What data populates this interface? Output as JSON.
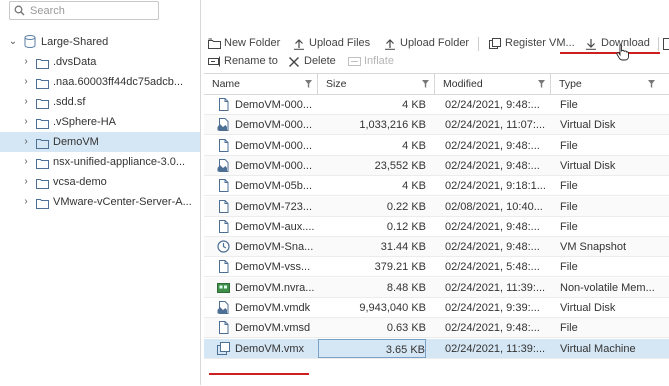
{
  "search": {
    "placeholder": "Search"
  },
  "tree": {
    "root_label": "Large-Shared",
    "items": [
      {
        "label": ".dvsData",
        "selected": false
      },
      {
        "label": ".naa.60003ff44dc75adcb...",
        "selected": false
      },
      {
        "label": ".sdd.sf",
        "selected": false
      },
      {
        "label": ".vSphere-HA",
        "selected": false
      },
      {
        "label": "DemoVM",
        "selected": true
      },
      {
        "label": "nsx-unified-appliance-3.0...",
        "selected": false
      },
      {
        "label": "vcsa-demo",
        "selected": false
      },
      {
        "label": "VMware-vCenter-Server-A...",
        "selected": false
      }
    ]
  },
  "toolbar": {
    "new_folder": "New Folder",
    "upload_files": "Upload Files",
    "upload_folder": "Upload Folder",
    "register_vm": "Register VM...",
    "download": "Download",
    "rename_to": "Rename to",
    "delete": "Delete",
    "inflate": "Inflate"
  },
  "columns": {
    "name": "Name",
    "size": "Size",
    "modified": "Modified",
    "type": "Type"
  },
  "files": [
    {
      "name": "DemoVM-000...",
      "size": "4 KB",
      "modified": "02/24/2021, 9:48:...",
      "type": "File",
      "icon": "file-icon",
      "selected": false
    },
    {
      "name": "DemoVM-000...",
      "size": "1,033,216 KB",
      "modified": "02/24/2021, 11:07:...",
      "type": "Virtual Disk",
      "icon": "virtual-disk-icon",
      "selected": false
    },
    {
      "name": "DemoVM-000...",
      "size": "4 KB",
      "modified": "02/24/2021, 9:48:...",
      "type": "File",
      "icon": "file-icon",
      "selected": false
    },
    {
      "name": "DemoVM-000...",
      "size": "23,552 KB",
      "modified": "02/24/2021, 9:48:...",
      "type": "Virtual Disk",
      "icon": "virtual-disk-icon",
      "selected": false
    },
    {
      "name": "DemoVM-05b...",
      "size": "4 KB",
      "modified": "02/24/2021, 9:18:1...",
      "type": "File",
      "icon": "file-icon",
      "selected": false
    },
    {
      "name": "DemoVM-723...",
      "size": "0.22 KB",
      "modified": "02/08/2021, 10:40...",
      "type": "File",
      "icon": "file-icon",
      "selected": false
    },
    {
      "name": "DemoVM-aux....",
      "size": "0.12 KB",
      "modified": "02/24/2021, 9:48:...",
      "type": "File",
      "icon": "file-icon",
      "selected": false
    },
    {
      "name": "DemoVM-Sna...",
      "size": "31.44 KB",
      "modified": "02/24/2021, 9:48:...",
      "type": "VM Snapshot",
      "icon": "vm-snapshot-icon",
      "selected": false
    },
    {
      "name": "DemoVM-vss...",
      "size": "379.21 KB",
      "modified": "02/24/2021, 5:48:...",
      "type": "File",
      "icon": "file-icon",
      "selected": false
    },
    {
      "name": "DemoVM.nvra...",
      "size": "8.48 KB",
      "modified": "02/24/2021, 11:39:...",
      "type": "Non-volatile Mem...",
      "icon": "nvram-icon",
      "selected": false
    },
    {
      "name": "DemoVM.vmdk",
      "size": "9,943,040 KB",
      "modified": "02/24/2021, 9:39:...",
      "type": "Virtual Disk",
      "icon": "virtual-disk-icon",
      "selected": false
    },
    {
      "name": "DemoVM.vmsd",
      "size": "0.63 KB",
      "modified": "02/24/2021, 9:48:...",
      "type": "File",
      "icon": "file-icon",
      "selected": false
    },
    {
      "name": "DemoVM.vmx",
      "size": "3.65 KB",
      "modified": "02/24/2021, 11:39:...",
      "type": "Virtual Machine",
      "icon": "virtual-machine-icon",
      "selected": true
    }
  ]
}
